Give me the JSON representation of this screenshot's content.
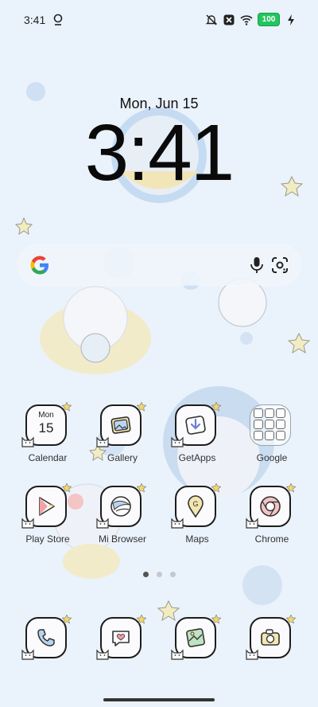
{
  "status_bar": {
    "time": "3:41",
    "battery": "100",
    "icons": [
      "notification-icon",
      "mute-icon",
      "close-box-icon",
      "wifi-icon",
      "battery-icon",
      "charging-icon"
    ]
  },
  "clock": {
    "date": "Mon, Jun 15",
    "time": "3:41"
  },
  "search": {
    "icons": [
      "google-g-icon",
      "microphone-icon",
      "google-lens-icon"
    ]
  },
  "apps": {
    "row1": [
      {
        "label": "Calendar",
        "day": "Mon",
        "date": "15",
        "icon": "calendar-icon"
      },
      {
        "label": "Gallery",
        "icon": "gallery-icon"
      },
      {
        "label": "GetApps",
        "icon": "getapps-icon"
      },
      {
        "label": "Google",
        "icon": "folder-icon"
      }
    ],
    "row2": [
      {
        "label": "Play Store",
        "icon": "play-store-icon"
      },
      {
        "label": "Mi Browser",
        "icon": "browser-icon"
      },
      {
        "label": "Maps",
        "icon": "maps-icon"
      },
      {
        "label": "Chrome",
        "icon": "chrome-icon"
      }
    ],
    "dock": [
      {
        "label": "",
        "icon": "phone-icon"
      },
      {
        "label": "",
        "icon": "messages-icon"
      },
      {
        "label": "",
        "icon": "gallery-photo-icon"
      },
      {
        "label": "",
        "icon": "camera-icon"
      }
    ]
  },
  "pages": {
    "count": 3,
    "active": 0
  },
  "colors": {
    "wallpaper": "#eaf2fb",
    "accent_blue": "#b9d3ef",
    "accent_yellow": "#f5ecc0",
    "battery": "#23c55e"
  }
}
